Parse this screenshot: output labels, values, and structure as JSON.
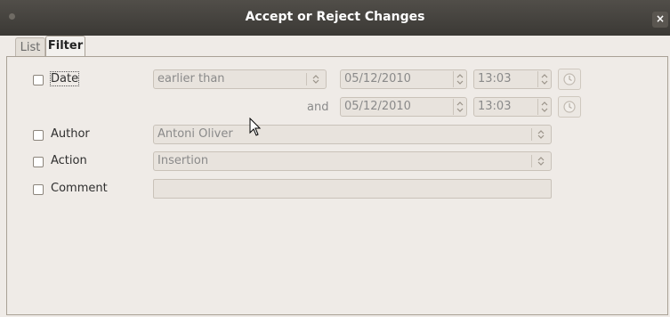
{
  "window": {
    "title": "Accept or Reject Changes",
    "close_glyph": "×"
  },
  "tabs": [
    {
      "label": "List"
    },
    {
      "label": "Filter"
    }
  ],
  "filter": {
    "date": {
      "label": "Date",
      "checked": false,
      "condition": "earlier than",
      "date1": "05/12/2010",
      "time1": "13:03",
      "and_label": "and",
      "date2": "05/12/2010",
      "time2": "13:03"
    },
    "author": {
      "label": "Author",
      "checked": false,
      "value": "Antoni Oliver"
    },
    "action": {
      "label": "Action",
      "checked": false,
      "value": "Insertion"
    },
    "comment": {
      "label": "Comment",
      "checked": false,
      "value": ""
    }
  },
  "icons": {
    "spin": "up-down-arrows-icon",
    "clock": "clock-icon",
    "cursor": "mouse-pointer-icon"
  }
}
